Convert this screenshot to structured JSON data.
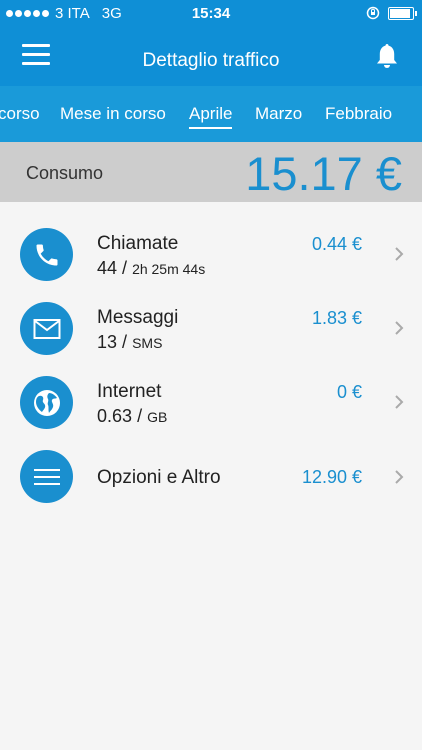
{
  "status": {
    "carrier": "3 ITA",
    "network": "3G",
    "time": "15:34"
  },
  "header": {
    "title": "Dettaglio traffico"
  },
  "tabs": [
    {
      "label": "corso"
    },
    {
      "label": "Mese in corso"
    },
    {
      "label": "Aprile",
      "active": true
    },
    {
      "label": "Marzo"
    },
    {
      "label": "Febbraio"
    }
  ],
  "consumo": {
    "label": "Consumo",
    "total": "15.17 €"
  },
  "items": [
    {
      "name": "Chiamate",
      "value": "44",
      "unit": "2h 25m 44s",
      "price": "0.44 €",
      "icon": "phone-icon"
    },
    {
      "name": "Messaggi",
      "value": "13",
      "unit": "SMS",
      "price": "1.83 €",
      "icon": "mail-icon"
    },
    {
      "name": "Internet",
      "value": "0.63",
      "unit": "GB",
      "price": "0 €",
      "icon": "globe-icon"
    },
    {
      "name": "Opzioni e Altro",
      "price": "12.90 €",
      "icon": "list-icon"
    }
  ],
  "colors": {
    "brand": "#0f8fd6",
    "accent": "#1a8fcf"
  }
}
